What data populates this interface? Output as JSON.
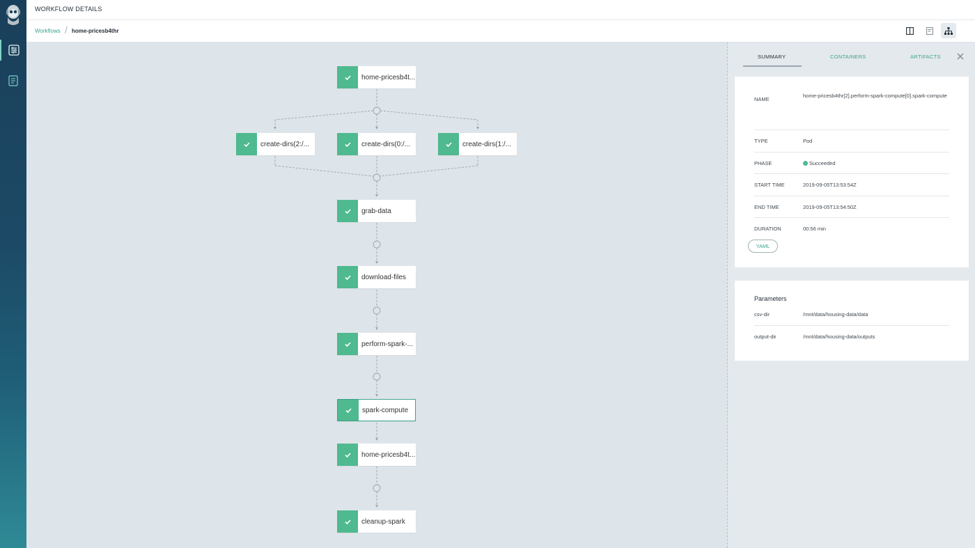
{
  "page": {
    "title": "WORKFLOW DETAILS"
  },
  "breadcrumb": {
    "parent": "Workflows",
    "current": "home-pricesb4thr"
  },
  "graph": {
    "nodes": [
      {
        "label": "home-pricesb4t...",
        "status": "Succeeded"
      },
      {
        "label": "create-dirs(2:/...",
        "status": "Succeeded"
      },
      {
        "label": "create-dirs(0:/...",
        "status": "Succeeded"
      },
      {
        "label": "create-dirs(1:/...",
        "status": "Succeeded"
      },
      {
        "label": "grab-data",
        "status": "Succeeded"
      },
      {
        "label": "download-files",
        "status": "Succeeded"
      },
      {
        "label": "perform-spark-...",
        "status": "Succeeded"
      },
      {
        "label": "spark-compute",
        "status": "Succeeded",
        "selected": true
      },
      {
        "label": "home-pricesb4t...",
        "status": "Succeeded"
      },
      {
        "label": "cleanup-spark",
        "status": "Succeeded"
      }
    ]
  },
  "panel": {
    "tabs": {
      "summary": "SUMMARY",
      "containers": "CONTAINERS",
      "artifacts": "ARTIFACTS"
    },
    "summary": {
      "name_key": "NAME",
      "name_val": "home-pricesb4thr[2].perform-spark-compute[0].spark-compute",
      "type_key": "TYPE",
      "type_val": "Pod",
      "phase_key": "PHASE",
      "phase_val": "Succeeded",
      "start_key": "START TIME",
      "start_val": "2019-09-05T13:53:54Z",
      "end_key": "END TIME",
      "end_val": "2019-09-05T13:54:50Z",
      "duration_key": "DURATION",
      "duration_val": "00:56 min",
      "yaml_label": "YAML"
    },
    "parameters": {
      "title": "Parameters",
      "items": [
        {
          "name": "csv-dir",
          "value": "/mnt/data/housing-data/data"
        },
        {
          "name": "output-dir",
          "value": "/mnt/data/housing-data/outputs"
        }
      ]
    }
  },
  "colors": {
    "accent": "#3ea38d",
    "success": "#4fb98f",
    "sidebar": "#1c4a66"
  },
  "icons": {
    "sidebar": [
      "workflows-icon",
      "workflow-templates-icon"
    ],
    "views": [
      "split-view-icon",
      "timeline-view-icon",
      "graph-view-icon"
    ]
  }
}
